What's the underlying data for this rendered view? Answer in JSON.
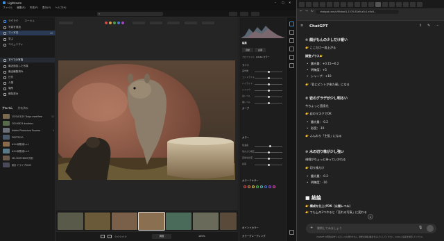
{
  "lightroom": {
    "title": "Lightroom",
    "menu": [
      "ファイル",
      "編集(E)",
      "写真(P)",
      "表示(V)",
      "ヘルプ(H)"
    ],
    "left_panel": {
      "app_label": "ラクラク",
      "local_label": "ローカル",
      "items": [
        {
          "label": "写真を追加"
        },
        {
          "label": "マイ写真",
          "count": "16"
        },
        {
          "label": "学ぶ"
        },
        {
          "label": "コミュニティ"
        }
      ],
      "my_photos_header": "すべての写真",
      "my_photos_items": [
        {
          "label": "最近追加した写真"
        },
        {
          "label": "最近編集済み"
        },
        {
          "label": "日付"
        },
        {
          "label": "人物"
        },
        {
          "label": "場所"
        },
        {
          "label": "削除済み"
        }
      ],
      "albums_header": "アルバム",
      "albums_tab2": "共有済み",
      "albums": [
        {
          "label": "2025/03/25 Tokyo meetfree",
          "count": "11",
          "color": "#7a6a4e"
        },
        {
          "label": "20240823 drodolux",
          "count": "",
          "color": "#556b4a"
        },
        {
          "label": "Adobe Photoshop Express",
          "count": "1",
          "color": "#6b6f78"
        },
        {
          "label": "PORT2020",
          "count": "",
          "color": "#4a5a6a"
        },
        {
          "label": "#04 和歌浦 Lv.1",
          "count": "",
          "color": "#8a6a4a"
        },
        {
          "label": "#04 和歌浦 Lv.2",
          "count": "",
          "color": "#5a7a8a"
        },
        {
          "label": "SEL300F28GM 作例",
          "count": "",
          "color": "#6a5a4a"
        },
        {
          "label": "東京 ドライブ2023",
          "count": "",
          "color": "#4a4a5a"
        }
      ]
    },
    "edit_panel": {
      "tabs": [
        "編集"
      ],
      "auto_label": "自動",
      "bw_label": "白黒",
      "profile_label": "プロファイル",
      "profile_value": "Adobe カラー",
      "light_section": "ライト",
      "light_sliders": [
        {
          "label": "露光量",
          "value": 0.5
        },
        {
          "label": "コントラスト",
          "value": 0.5
        },
        {
          "label": "ハイライト",
          "value": 0.5
        },
        {
          "label": "シャドウ",
          "value": 0.5
        },
        {
          "label": "白レベル",
          "value": 0.5
        },
        {
          "label": "黒レベル",
          "value": 0.5
        }
      ],
      "curve_section": "カーブ",
      "color_section": "カラー",
      "color_sliders": [
        {
          "label": "色温度",
          "value": 0.55
        },
        {
          "label": "色かぶり補正",
          "value": 0.5
        },
        {
          "label": "自然な彩度",
          "value": 0.5
        },
        {
          "label": "彩度",
          "value": 0.5
        }
      ],
      "mixer_section": "カラーミキサー",
      "effects_section": "ポイントカラー",
      "grading_section": "カラーグレーディング"
    },
    "status": {
      "zoom": "100%",
      "fit": "調整"
    }
  },
  "browser": {
    "url": "chatgpt.com/c/6fcbad1-1570-83a9-a3c1-e0c8...",
    "chatgpt_title": "ChatGPT",
    "content": {
      "s1_title": "① 顔がもんの少しだけ暖い",
      "s1_l1": "👉 ここだけ一段上がる",
      "s1_sub": "調整プラス👉",
      "s1_items": [
        "露光量：+0.15〜0.2",
        "明瞭度：+5",
        "シャープ：+10"
      ],
      "s1_note": "👉「目にピントが来た感」になる",
      "s2_title": "② 岩のグラデが少し明るい",
      "s2_l1": "今ちょっと直接光",
      "s2_l2": "👉 岩のマスクでOK",
      "s2_items": [
        "露光量：-0.2",
        "彩度：-10"
      ],
      "s2_note": "👉 ふんわり「主役」になる",
      "s3_title": "③ 木の切り株が少し強い",
      "s3_l1": "視線がちょっと持っていかれる",
      "s3_l2": "👉 切り株だけ",
      "s3_items": [
        "露光量：-0.2",
        "明瞭度：-10"
      ],
      "conclusion": "■ 結論",
      "c1": "👉 構成を仕上げOK（公開レベル）",
      "c2": "👉 でも上の3つやると「売れる写真」に変わる"
    },
    "input_placeholder": "質問してみましょう",
    "footer": "ChatGPT の回答は必ずしも正しいとは限りません。重要な情報は確認するようにしてください。cookie の設定を参照してください。"
  }
}
